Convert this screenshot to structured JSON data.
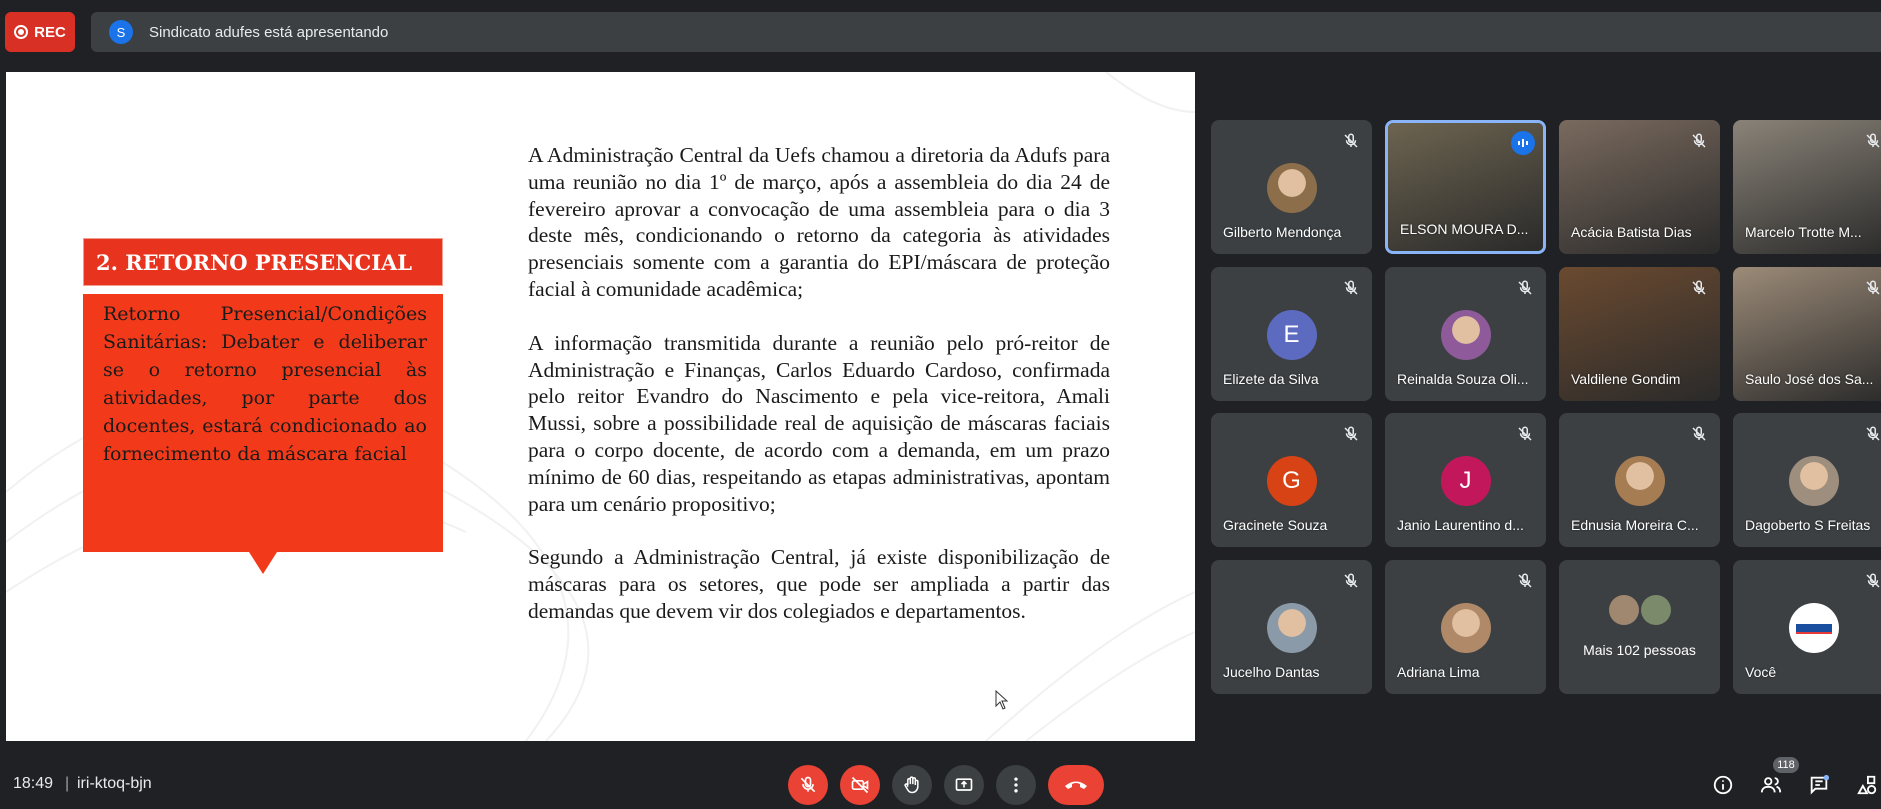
{
  "top": {
    "rec_label": "REC",
    "presenter_initial": "S",
    "presenting_text": "Sindicato adufes está apresentando"
  },
  "slide": {
    "title": "2. RETORNO PRESENCIAL",
    "box_text": "Retorno Presencial/Condições Sanitárias: Debater e deliberar se o retorno presencial às atividades, por parte dos docentes, estará condicionado ao fornecimento da máscara facial",
    "paragraphs": [
      "A Administração Central da Uefs chamou a diretoria da Adufs para uma reunião no dia 1º de março, após a assembleia do dia 24 de fevereiro aprovar a convocação de uma assembleia para o dia 3 deste mês, condicionando o retorno da categoria às atividades presenciais somente com a garantia do EPI/máscara de proteção facial à comunidade acadêmica;",
      "A informação transmitida durante a reunião pelo pró-reitor de Administração e Finanças, Carlos Eduardo Cardoso, confirmada pelo reitor Evandro do Nascimento e pela vice-reitora, Amali Mussi, sobre a possibilidade real de aquisição de máscaras faciais para o corpo docente, de acordo com a demanda, em um prazo mínimo de 60 dias, respeitando as etapas administrativas, apontam para um cenário propositivo;",
      "Segundo a Administração Central, já existe disponibilização de máscaras para os setores, que pode ser ampliada a partir das demandas que devem vir dos colegiados e departamentos."
    ]
  },
  "participants": [
    {
      "name": "Gilberto Mendonça",
      "initial": "",
      "color": "#8d6e4a",
      "kind": "photo-avatar"
    },
    {
      "name": "ELSON MOURA D...",
      "initial": "",
      "color": "#6d6450",
      "kind": "video",
      "active": true
    },
    {
      "name": "Acácia Batista Dias",
      "initial": "",
      "color": "#7a6a5e",
      "kind": "video"
    },
    {
      "name": "Marcelo Trotte M...",
      "initial": "",
      "color": "#8a8378",
      "kind": "video"
    },
    {
      "name": "Elizete da Silva",
      "initial": "E",
      "color": "#5c6bc0",
      "kind": "letter"
    },
    {
      "name": "Reinalda Souza Oli...",
      "initial": "",
      "color": "#8e5a9a",
      "kind": "photo-avatar"
    },
    {
      "name": "Valdilene Gondim",
      "initial": "",
      "color": "#6b4a30",
      "kind": "video"
    },
    {
      "name": "Saulo José dos Sa...",
      "initial": "",
      "color": "#9c8b78",
      "kind": "video"
    },
    {
      "name": "Gracinete Souza",
      "initial": "G",
      "color": "#d84315",
      "kind": "letter"
    },
    {
      "name": "Janio Laurentino d...",
      "initial": "J",
      "color": "#c2185b",
      "kind": "letter"
    },
    {
      "name": "Ednusia Moreira C...",
      "initial": "",
      "color": "#a67c52",
      "kind": "photo-avatar"
    },
    {
      "name": "Dagoberto S Freitas",
      "initial": "",
      "color": "#9e8e7e",
      "kind": "photo-avatar"
    },
    {
      "name": "Jucelho Dantas",
      "initial": "",
      "color": "#8a9aa8",
      "kind": "photo-avatar"
    },
    {
      "name": "Adriana Lima",
      "initial": "",
      "color": "#b08968",
      "kind": "photo-avatar"
    },
    {
      "name": "Mais 102 pessoas",
      "initial": "",
      "color": "#5f6368",
      "kind": "more"
    },
    {
      "name": "Você",
      "initial": "",
      "color": "#ffffff",
      "kind": "logo"
    }
  ],
  "bottom": {
    "time": "18:49",
    "separator": "|",
    "meeting_code": "iri-ktoq-bjn",
    "participant_count": "118"
  },
  "colors": {
    "background": "#202124",
    "tile": "#3c4043",
    "danger": "#ea4335",
    "slide_accent": "#f23a1a",
    "active_border": "#8ab4f8"
  }
}
